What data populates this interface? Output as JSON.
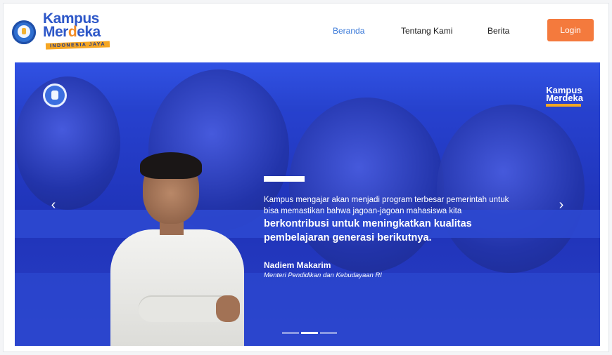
{
  "header": {
    "logo": {
      "line1": "Kampus",
      "line2_main": "Mer",
      "line2_accent": "d",
      "line2_end": "eka",
      "tag": "INDONESIA JAYA"
    },
    "nav": [
      {
        "label": "Beranda",
        "active": true
      },
      {
        "label": "Tentang Kami",
        "active": false
      },
      {
        "label": "Berita",
        "active": false
      }
    ],
    "login_label": "Login"
  },
  "hero": {
    "logo": {
      "line1": "Kampus",
      "line2": "Merdeka"
    },
    "quote": {
      "normal": "Kampus mengajar akan menjadi program terbesar pemerintah untuk bisa memastikan bahwa jagoan-jagoan mahasiswa kita",
      "strong": "berkontribusi untuk meningkatkan kualitas pembelajaran generasi berikutnya."
    },
    "author": {
      "name": "Nadiem Makarim",
      "role": "Menteri Pendidikan dan Kebudayaan RI"
    },
    "prev_icon": "‹",
    "next_icon": "›",
    "slides": [
      {
        "active": false
      },
      {
        "active": true
      },
      {
        "active": false
      }
    ]
  },
  "colors": {
    "brand_blue": "#2d57c8",
    "accent_orange": "#f47a3d",
    "hero_blue": "#2a47d8"
  }
}
